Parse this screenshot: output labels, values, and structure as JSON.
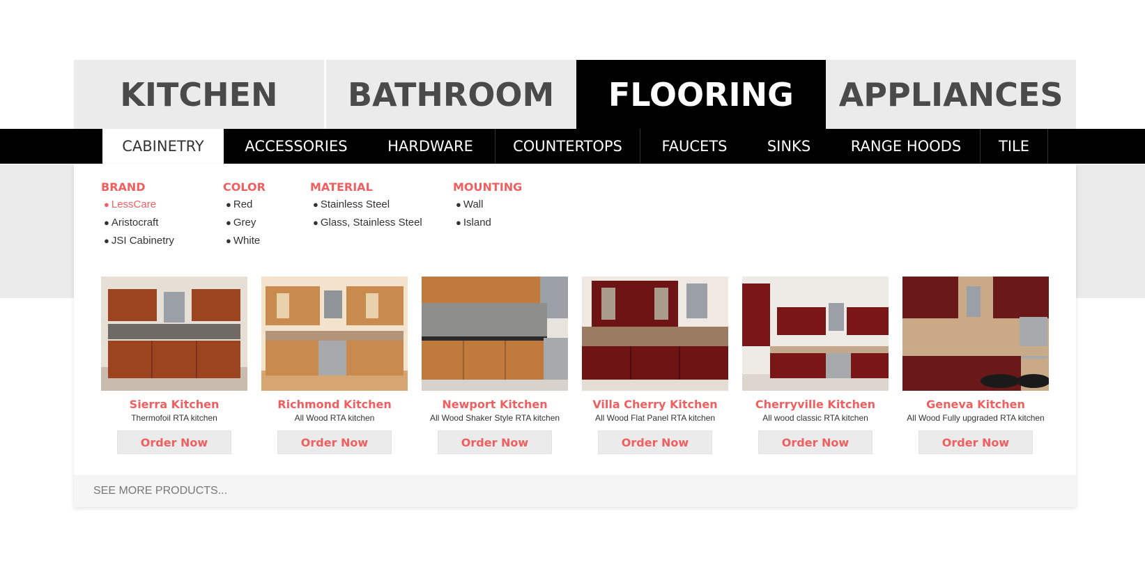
{
  "top_tabs": [
    {
      "label": "KITCHEN",
      "active": false
    },
    {
      "label": "BATHROOM",
      "active": false
    },
    {
      "label": "FLOORING",
      "active": true
    },
    {
      "label": "APPLIANCES",
      "active": false
    }
  ],
  "sub_tabs": [
    {
      "label": "CABINETRY",
      "active": true
    },
    {
      "label": "ACCESSORIES",
      "active": false
    },
    {
      "label": "HARDWARE",
      "active": false
    },
    {
      "label": "COUNTERTOPS",
      "active": false
    },
    {
      "label": "FAUCETS",
      "active": false
    },
    {
      "label": "SINKS",
      "active": false
    },
    {
      "label": "RANGE HOODS",
      "active": false
    },
    {
      "label": "TILE",
      "active": false
    }
  ],
  "filters": {
    "brand": {
      "heading": "BRAND",
      "items": [
        "LessCare",
        "Aristocraft",
        "JSI Cabinetry"
      ],
      "selected": "LessCare"
    },
    "color": {
      "heading": "COLOR",
      "items": [
        "Red",
        "Grey",
        "White"
      ]
    },
    "material": {
      "heading": "MATERIAL",
      "items": [
        "Stainless Steel",
        "Glass, Stainless Steel"
      ]
    },
    "mounting": {
      "heading": "MOUNTING",
      "items": [
        "Wall",
        "Island"
      ]
    }
  },
  "products": [
    {
      "name": "Sierra Kitchen",
      "subtitle": "Thermofoil RTA kitchen",
      "button": "Order Now",
      "cabinet_color": "#9c4420"
    },
    {
      "name": "Richmond Kitchen",
      "subtitle": "All Wood RTA kitchen",
      "button": "Order Now",
      "cabinet_color": "#c98a4e"
    },
    {
      "name": "Newport Kitchen",
      "subtitle": "All Wood Shaker Style RTA kitchen",
      "button": "Order Now",
      "cabinet_color": "#c07a3e"
    },
    {
      "name": "Villa Cherry Kitchen",
      "subtitle": "All Wood Flat Panel RTA kitchen",
      "button": "Order Now",
      "cabinet_color": "#6e1414"
    },
    {
      "name": "Cherryville Kitchen",
      "subtitle": "All wood classic RTA kitchen",
      "button": "Order Now",
      "cabinet_color": "#7a1616"
    },
    {
      "name": "Geneva Kitchen",
      "subtitle": "All Wood Fully upgraded RTA kitchen",
      "button": "Order Now",
      "cabinet_color": "#6a1818"
    }
  ],
  "see_more": "SEE MORE PRODUCTS...",
  "colors": {
    "accent": "#f05f5f",
    "nav_bg": "#000000",
    "tab_bg": "#ebebeb"
  }
}
